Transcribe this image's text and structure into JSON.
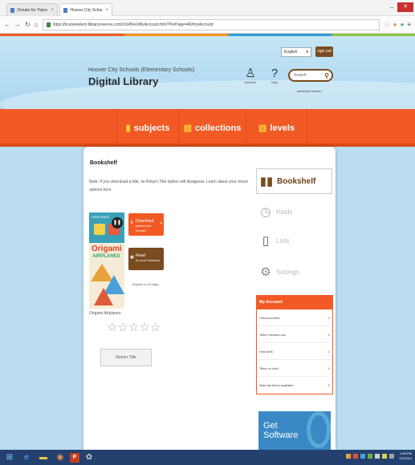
{
  "browser": {
    "tabs": [
      {
        "label": "Donate for 'Hann Perfect'",
        "active": false
      },
      {
        "label": "Hoover City Schools (Ele",
        "active": true
      }
    ],
    "url": "https://hcsnewelem.libraryreserve.com/10/45/en/MyAccount.htm?PerPage=40#myAccount"
  },
  "header": {
    "district": "Hoover City Schools (Elementary Schools)",
    "title": "Digital Library",
    "language": "English",
    "signout": "sign out",
    "account_label": "account",
    "help_label": "help",
    "search_placeholder": "Search",
    "advanced_search": "advanced search"
  },
  "nav": {
    "items": [
      {
        "label": "subjects",
        "icon": "book-icon"
      },
      {
        "label": "collections",
        "icon": "stack-icon"
      },
      {
        "label": "levels",
        "icon": "levels-icon"
      }
    ]
  },
  "main": {
    "section_title": "Bookshelf",
    "notice": "Note: If you download a title, its Return Title button will disappear. Learn about your return options here",
    "book": {
      "title": "Origami Airplanes",
      "cover_subtitle": "AIRPLANES",
      "cover_word": "Origami",
      "download_label": "Download",
      "download_sub": "(select one format)",
      "read_label": "Read",
      "read_sub": "(in your browser)",
      "expires": "Expires in 14 days",
      "rating": 0,
      "return_label": "Return Title"
    }
  },
  "sidebar": {
    "items": [
      {
        "label": "Bookshelf",
        "icon": "books-icon",
        "active": true
      },
      {
        "label": "Holds",
        "icon": "clock-icon",
        "active": false
      },
      {
        "label": "Lists",
        "icon": "clipboard-icon",
        "active": false
      },
      {
        "label": "Settings",
        "icon": "gear-icon",
        "active": false
      }
    ]
  },
  "account": {
    "header": "My Account:",
    "rows": [
      {
        "label": "Checkout limit:",
        "value": "1"
      },
      {
        "label": "Titles checked out:",
        "value": "1"
      },
      {
        "label": "Hold limit:",
        "value": "1"
      },
      {
        "label": "Titles on hold:",
        "value": "1"
      },
      {
        "label": "Wish list items available:",
        "value": "0"
      }
    ]
  },
  "promo": {
    "text_line1": "Get",
    "text_line2": "Software"
  },
  "taskbar": {
    "time": "1:08 PM",
    "date": "1/1/2014"
  },
  "colors": {
    "brand_orange": "#f15a24",
    "brand_brown": "#7a4b1f"
  }
}
